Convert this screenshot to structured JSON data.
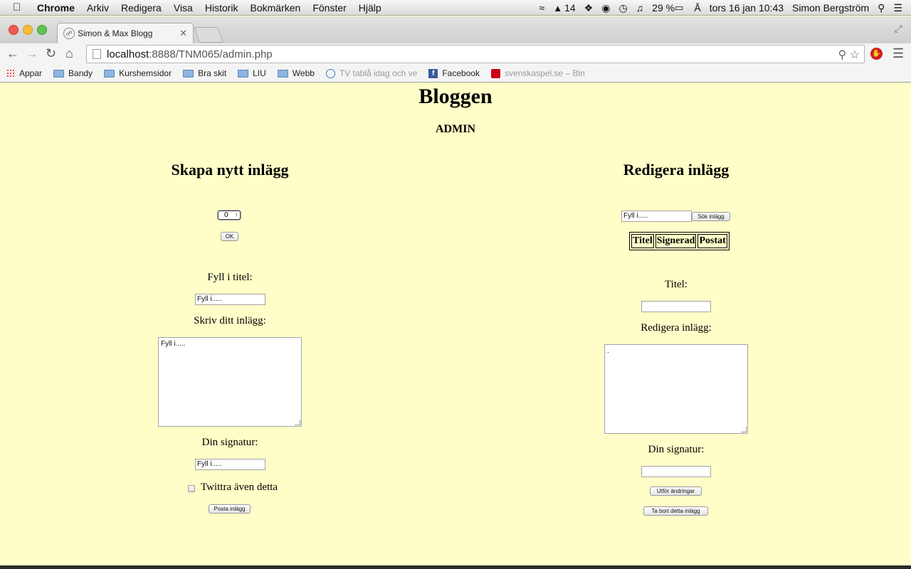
{
  "menubar": {
    "app": "Chrome",
    "items": [
      "Arkiv",
      "Redigera",
      "Visa",
      "Historik",
      "Bokmärken",
      "Fönster",
      "Hjälp"
    ],
    "status": {
      "count": "14",
      "battery": "29 %",
      "clock": "tors 16 jan  10:43",
      "user": "Simon Bergström"
    }
  },
  "browser": {
    "tab_title": "Simon & Max Blogg",
    "url_host": "localhost",
    "url_path": ":8888/TNM065/admin.php",
    "bookmarks": [
      "Appar",
      "Bandy",
      "Kurshemsidor",
      "Bra skit",
      "LIU",
      "Webb",
      "TV tablå idag och ve",
      "Facebook",
      "svenskaspel.se – Bin"
    ]
  },
  "page": {
    "title": "Bloggen",
    "subtitle": "ADMIN",
    "create": {
      "heading": "Skapa nytt inlägg",
      "select_value": "0",
      "ok_label": "OK",
      "title_label": "Fyll i titel:",
      "title_value": "Fyll i.....",
      "body_label": "Skriv ditt inlägg:",
      "body_value": "Fyll i.....",
      "signature_label": "Din signatur:",
      "signature_value": "Fyll i.....",
      "tweet_label": "Twittra även detta",
      "submit_label": "Posta inlägg"
    },
    "edit": {
      "heading": "Redigera inlägg",
      "search_value": "Fyll i.....",
      "search_button": "Sök inlägg",
      "table_headers": [
        "Titel",
        "Signerad",
        "Postat"
      ],
      "title_label": "Titel:",
      "title_value": "",
      "body_label": "Redigera inlägg:",
      "body_value": ".",
      "signature_label": "Din signatur:",
      "signature_value": "",
      "save_label": "Utför ändringar",
      "delete_label": "Ta bort detta inlägg"
    }
  },
  "colors": {
    "page_bg": "#fffec8"
  }
}
